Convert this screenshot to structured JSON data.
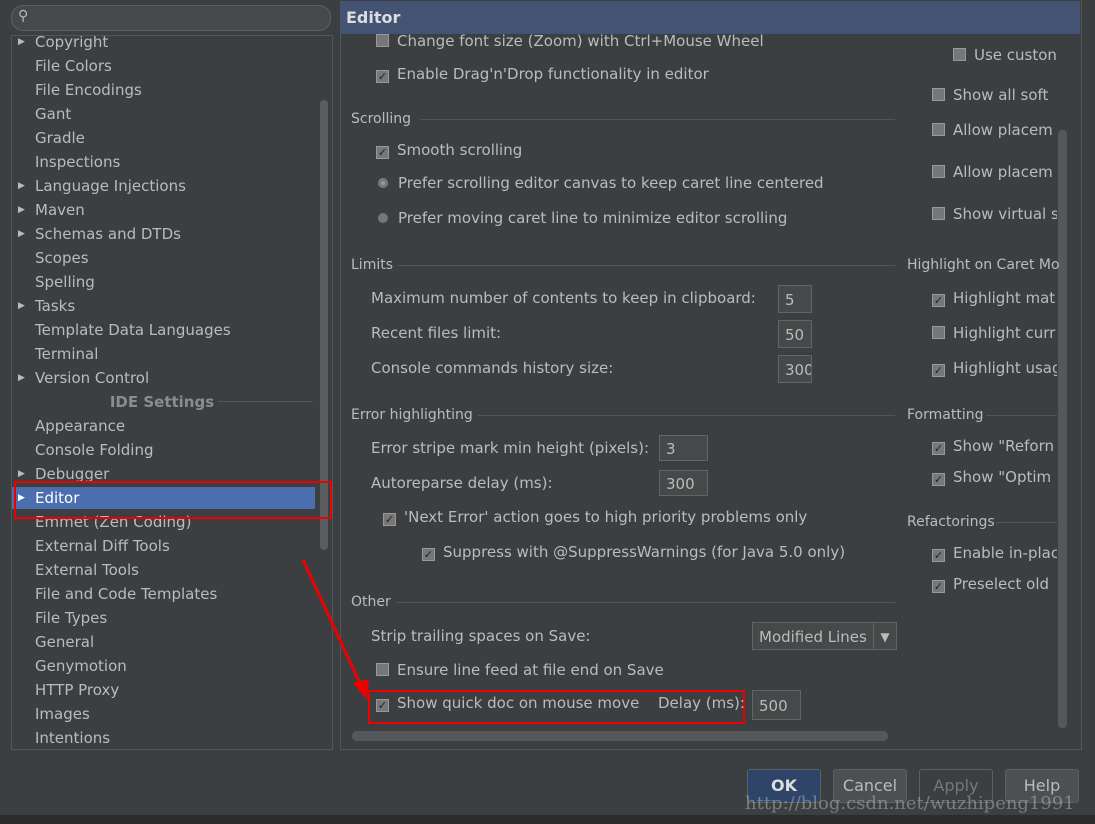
{
  "search": {
    "placeholder": ""
  },
  "sidebar": {
    "items": [
      {
        "label": "Copyright",
        "arrow": true
      },
      {
        "label": "File Colors"
      },
      {
        "label": "File Encodings"
      },
      {
        "label": "Gant"
      },
      {
        "label": "Gradle"
      },
      {
        "label": "Inspections"
      },
      {
        "label": "Language Injections",
        "arrow": true
      },
      {
        "label": "Maven",
        "arrow": true
      },
      {
        "label": "Schemas and DTDs",
        "arrow": true
      },
      {
        "label": "Scopes"
      },
      {
        "label": "Spelling"
      },
      {
        "label": "Tasks",
        "arrow": true
      },
      {
        "label": "Template Data Languages"
      },
      {
        "label": "Terminal"
      },
      {
        "label": "Version Control",
        "arrow": true
      },
      {
        "label": "IDE Settings",
        "header": true
      },
      {
        "label": "Appearance"
      },
      {
        "label": "Console Folding"
      },
      {
        "label": "Debugger",
        "arrow": true
      },
      {
        "label": "Editor",
        "arrow": true,
        "selected": true
      },
      {
        "label": "Emmet (Zen Coding)"
      },
      {
        "label": "External Diff Tools"
      },
      {
        "label": "External Tools"
      },
      {
        "label": "File and Code Templates"
      },
      {
        "label": "File Types"
      },
      {
        "label": "General"
      },
      {
        "label": "Genymotion"
      },
      {
        "label": "HTTP Proxy"
      },
      {
        "label": "Images"
      },
      {
        "label": "Intentions"
      }
    ]
  },
  "editor": {
    "title": "Editor",
    "top": [
      {
        "label": "Change font size (Zoom) with Ctrl+Mouse Wheel",
        "checked": false
      },
      {
        "label": "Enable Drag'n'Drop functionality in editor",
        "checked": true
      }
    ],
    "scrolling": {
      "title": "Scrolling",
      "smooth": "Smooth scrolling",
      "radio1": "Prefer scrolling editor canvas to keep caret line centered",
      "radio2": "Prefer moving caret line to minimize editor scrolling"
    },
    "limits": {
      "title": "Limits",
      "rows": [
        {
          "label": "Maximum number of contents to keep in clipboard:",
          "value": "5"
        },
        {
          "label": "Recent files limit:",
          "value": "50"
        },
        {
          "label": "Console commands history size:",
          "value": "300"
        }
      ]
    },
    "error": {
      "title": "Error highlighting",
      "stripe_label": "Error stripe mark min height (pixels):",
      "stripe_value": "3",
      "reparse_label": "Autoreparse delay (ms):",
      "reparse_value": "300",
      "next_error": "'Next Error' action goes to high priority problems only",
      "suppress": "Suppress with @SuppressWarnings (for Java 5.0 only)"
    },
    "other": {
      "title": "Other",
      "strip_label": "Strip trailing spaces on Save:",
      "strip_value": "Modified Lines",
      "line_feed": "Ensure line feed at file end on Save",
      "quick_doc": "Show quick doc on mouse move",
      "delay_label": "Delay (ms):",
      "delay_value": "500"
    },
    "right": {
      "top": [
        {
          "label": "Use custon",
          "checked": false
        },
        {
          "label": "Show all soft",
          "checked": false
        },
        {
          "label": "Allow placem",
          "checked": false
        },
        {
          "label": "Allow placem",
          "checked": false
        },
        {
          "label": "Show virtual s",
          "checked": false
        }
      ],
      "caret_title": "Highlight on Caret Mo",
      "caret": [
        {
          "label": "Highlight mat",
          "checked": true
        },
        {
          "label": "Highlight curr",
          "checked": false
        },
        {
          "label": "Highlight usag",
          "checked": true
        }
      ],
      "format_title": "Formatting",
      "format": [
        {
          "label": "Show \"Reforn",
          "checked": true
        },
        {
          "label": "Show \"Optim",
          "checked": true
        }
      ],
      "refactor_title": "Refactorings",
      "refactor": [
        {
          "label": "Enable in-plac",
          "checked": true
        },
        {
          "label": "Preselect old",
          "checked": true
        }
      ]
    }
  },
  "buttons": {
    "ok": "OK",
    "cancel": "Cancel",
    "apply": "Apply",
    "help": "Help"
  },
  "watermark": "http://blog.csdn.net/wuzhipeng1991",
  "colors": {
    "accent": "#4b6eaf",
    "highlight": "#e00000"
  }
}
